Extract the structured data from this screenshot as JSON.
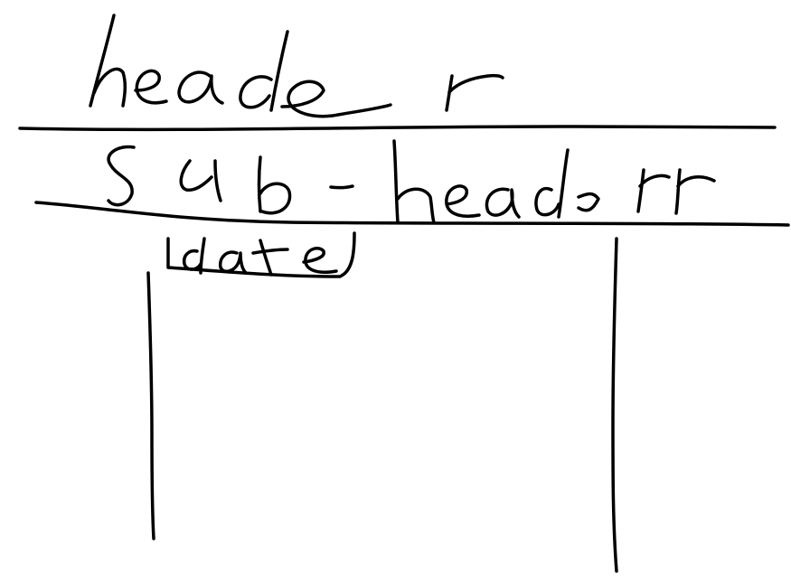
{
  "header": {
    "text": "header"
  },
  "sub_header": {
    "text": "sub-header"
  },
  "date_label": {
    "text": "date"
  },
  "ink_color": "#000000",
  "background_color": "#ffffff"
}
